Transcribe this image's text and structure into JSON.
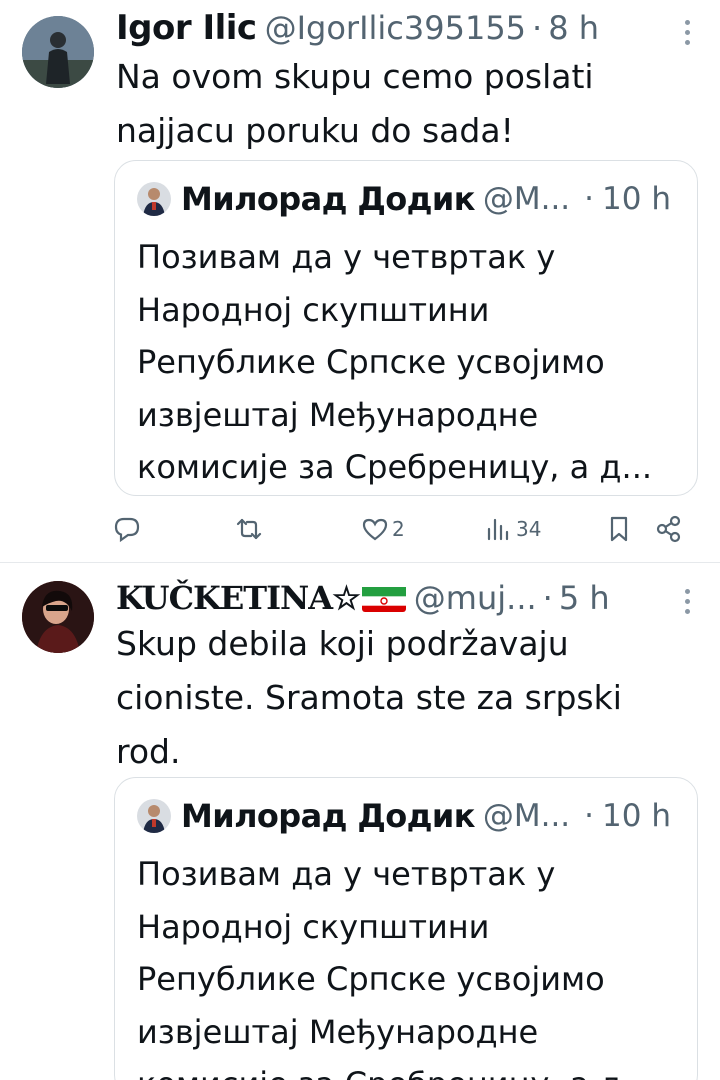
{
  "tweets": [
    {
      "display_name": "Igor Ilic",
      "handle": "@IgorIlic395155",
      "separator": "·",
      "time": "8 h",
      "text_lines": [
        "Na ovom skupu cemo poslati",
        "najjacu poruku do sada!"
      ],
      "quote": {
        "display_name": "Милорад Додик",
        "handle": "@M...",
        "separator": "·",
        "time": "10 h",
        "text_lines": [
          "Позивам да у четвртак у",
          "Народној скупштини",
          "Републике Српске усвојимо",
          "извјештај Међународне",
          "комисије за Сребреницу, а д..."
        ]
      },
      "actions": {
        "reply_icon": "reply-icon",
        "retweet_icon": "retweet-icon",
        "like_icon": "heart-icon",
        "like_count": "2",
        "views_icon": "views-icon",
        "views_count": "34",
        "bookmark_icon": "bookmark-icon",
        "share_icon": "share-icon"
      }
    },
    {
      "display_name": "KUČKETINA☆",
      "flag_icon": "iran-flag-icon",
      "handle": "@muj...",
      "separator": "·",
      "time": "5 h",
      "text_lines": [
        "Skup debila koji podržavaju",
        "cioniste. Sramota ste za srpski",
        "rod."
      ],
      "quote": {
        "display_name": "Милорад Додик",
        "handle": "@M...",
        "separator": "·",
        "time": "10 h",
        "text_lines": [
          "Позивам да у четвртак у",
          "Народној скупштини",
          "Републике Српске усвојимо",
          "извјештај Међународне",
          "комисије за Сребреницу, а д..."
        ]
      }
    }
  ],
  "colors": {
    "text": "#0f1419",
    "secondary": "#536471",
    "border": "#dbe0e4",
    "flag_green": "#239f40",
    "flag_red": "#da0000"
  }
}
